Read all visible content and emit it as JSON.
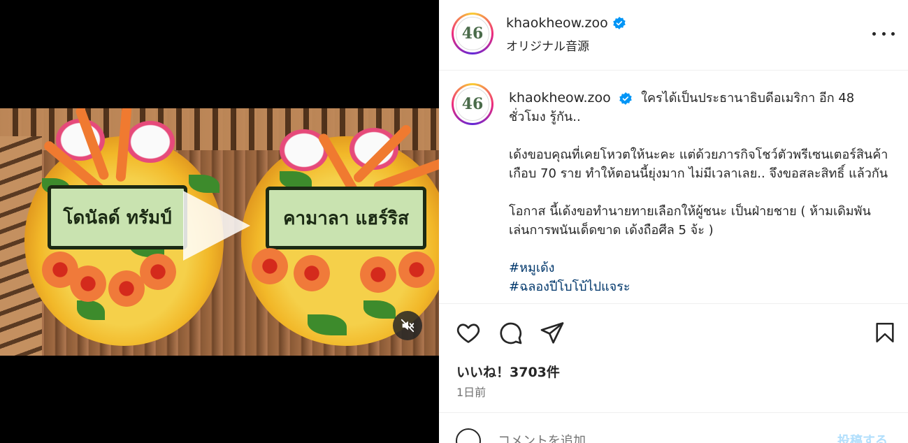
{
  "header": {
    "username": "khaokheow.zoo",
    "audio": "オリジナル音源",
    "avatar_text": "46"
  },
  "video": {
    "plaque_left": "โดนัลด์ ทรัมป์",
    "plaque_right": "คามาลา แฮร์ริส"
  },
  "caption": {
    "username": "khaokheow.zoo",
    "line1": "ใครได้เป็นประธานาธิบดีอเมริกา อีก 48 ชั่วโมง รู้กัน..",
    "para2": "เด้งขอบคุณที่เคยโหวตให้นะคะ แต่ด้วยภารกิจโชว์ตัวพรีเซนเตอร์สินค้า เกือบ 70 ราย ทำให้ตอนนี้ยุ่งมาก ไม่มีเวลาเลย.. จึงขอสละสิทธิ์ แล้วกัน",
    "para3": "โอกาส นี้เด้งขอทำนายทายเลือกให้ผู้ชนะ เป็นฝ่ายชาย ( ห้ามเดิมพัน เล่นการพนันเด็ดขาด เด้งถือศีล 5 จ้ะ )",
    "hashtag1": "#หมูเด้ง",
    "hashtag2": "#ฉลองปีโบโบ้ไปแจระ"
  },
  "engagement": {
    "likes": "いいね！3703件",
    "time": "1日前"
  },
  "comment": {
    "placeholder": "コメントを追加...",
    "post_label": "投稿する"
  },
  "colors": {
    "verified": "#0095f6",
    "link": "#00376b",
    "post_disabled": "#b2dffc"
  },
  "icons": [
    "heart-icon",
    "comment-icon",
    "share-icon",
    "bookmark-icon",
    "more-icon",
    "verified-icon",
    "mute-icon",
    "play-icon",
    "emoji-icon"
  ]
}
